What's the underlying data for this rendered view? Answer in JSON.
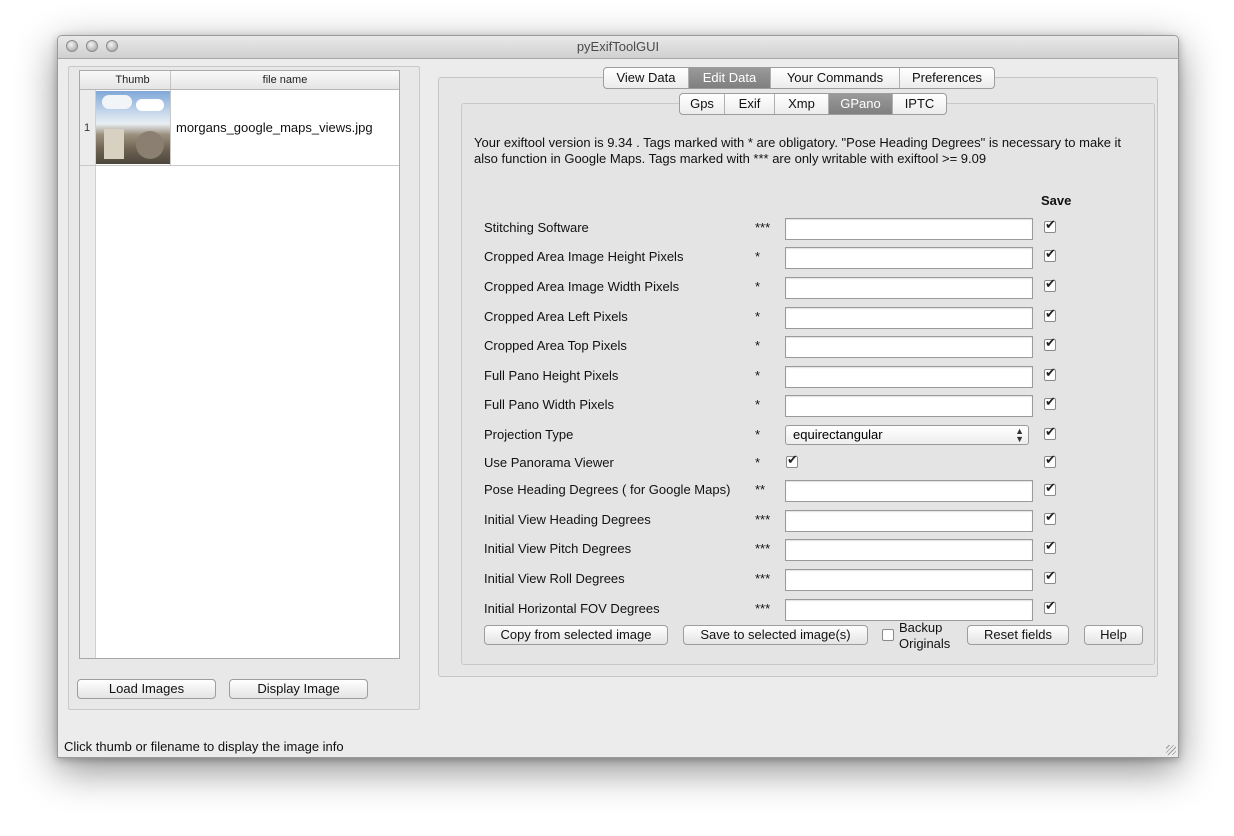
{
  "window": {
    "title": "pyExifToolGUI"
  },
  "images": {
    "columns": [
      "Thumb",
      "file name"
    ],
    "rows": [
      {
        "num": "1",
        "filename": "morgans_google_maps_views.jpg"
      }
    ],
    "load_button": "Load Images",
    "display_button": "Display Image"
  },
  "main_tabs": [
    "View Data",
    "Edit Data",
    "Your Commands",
    "Preferences"
  ],
  "sub_tabs": [
    "Gps",
    "Exif",
    "Xmp",
    "GPano",
    "IPTC"
  ],
  "info_text": "Your exiftool version is 9.34 . Tags marked with * are obligatory. \"Pose Heading Degrees\" is necessary to make it also function in Google Maps. Tags marked with *** are only writable with exiftool >= 9.09",
  "save_header": "Save",
  "fields": [
    {
      "label": "Stitching Software",
      "marker": "***",
      "value": ""
    },
    {
      "label": "Cropped Area Image Height Pixels",
      "marker": "*",
      "value": ""
    },
    {
      "label": "Cropped Area Image Width Pixels",
      "marker": "*",
      "value": ""
    },
    {
      "label": "Cropped Area Left Pixels",
      "marker": "*",
      "value": ""
    },
    {
      "label": "Cropped Area Top Pixels",
      "marker": "*",
      "value": ""
    },
    {
      "label": "Full Pano Height Pixels",
      "marker": "*",
      "value": ""
    },
    {
      "label": "Full Pano Width Pixels",
      "marker": "*",
      "value": ""
    },
    {
      "label": "Projection Type",
      "marker": "*",
      "value": "equirectangular"
    },
    {
      "label": "Use Panorama Viewer",
      "marker": "*",
      "value": ""
    },
    {
      "label": "Pose Heading Degrees ( for Google Maps)",
      "marker": "**",
      "value": ""
    },
    {
      "label": "Initial View Heading Degrees",
      "marker": "***",
      "value": ""
    },
    {
      "label": "Initial View Pitch Degrees",
      "marker": "***",
      "value": ""
    },
    {
      "label": "Initial View Roll Degrees",
      "marker": "***",
      "value": ""
    },
    {
      "label": "Initial Horizontal FOV Degrees",
      "marker": "***",
      "value": ""
    }
  ],
  "actions": {
    "copy": "Copy from selected image",
    "save": "Save to selected image(s)",
    "backup_line1": "Backup",
    "backup_line2": "Originals",
    "reset": "Reset fields",
    "help": "Help"
  },
  "status_text": "Click thumb or filename to display the image info"
}
